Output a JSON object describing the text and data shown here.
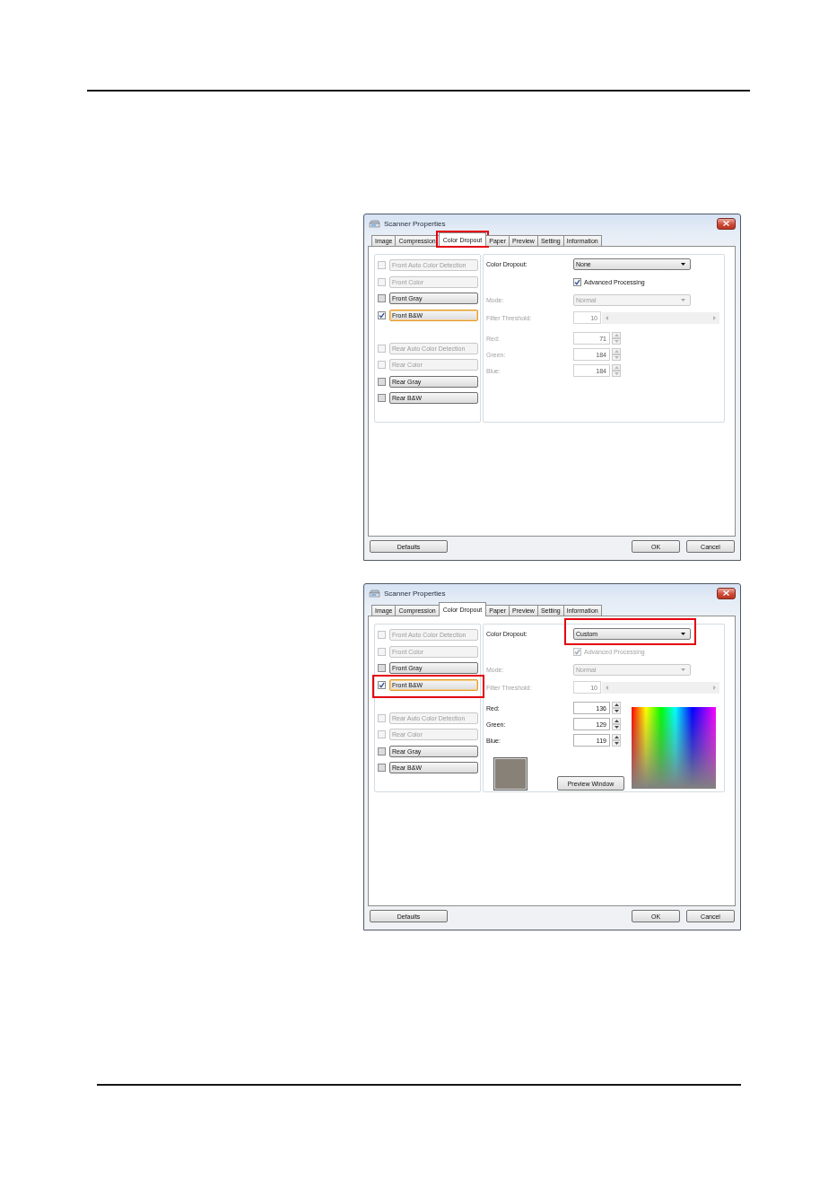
{
  "dialogs": [
    {
      "window": {
        "title": "Scanner Properties"
      },
      "tabs": [
        {
          "label": "Image",
          "selected": false,
          "highlighted": false
        },
        {
          "label": "Compression",
          "selected": false,
          "highlighted": false
        },
        {
          "label": "Color Dropout",
          "selected": true,
          "highlighted": true
        },
        {
          "label": "Paper",
          "selected": false,
          "highlighted": false
        },
        {
          "label": "Preview",
          "selected": false,
          "highlighted": false
        },
        {
          "label": "Setting",
          "selected": false,
          "highlighted": false
        },
        {
          "label": "Information",
          "selected": false,
          "highlighted": false
        }
      ],
      "option_groups": [
        {
          "options": [
            {
              "label": "Front Auto Color Detection",
              "checked": false,
              "disabled": true,
              "focused": false,
              "highlighted": false
            },
            {
              "label": "Front Color",
              "checked": false,
              "disabled": true,
              "focused": false,
              "highlighted": false
            },
            {
              "label": "Front Gray",
              "checked": false,
              "disabled": false,
              "focused": false,
              "highlighted": false
            },
            {
              "label": "Front B&W",
              "checked": true,
              "disabled": false,
              "focused": true,
              "highlighted": false
            }
          ]
        },
        {
          "options": [
            {
              "label": "Rear Auto Color Detection",
              "checked": false,
              "disabled": true,
              "focused": false,
              "highlighted": false
            },
            {
              "label": "Rear Color",
              "checked": false,
              "disabled": true,
              "focused": false,
              "highlighted": false
            },
            {
              "label": "Rear Gray",
              "checked": false,
              "disabled": false,
              "focused": false,
              "highlighted": false
            },
            {
              "label": "Rear B&W",
              "checked": false,
              "disabled": false,
              "focused": false,
              "highlighted": false
            }
          ]
        }
      ],
      "settings": {
        "color_dropout": {
          "label": "Color Dropout:",
          "value": "None",
          "highlighted": false
        },
        "advanced_processing": {
          "label": "Advanced Processing",
          "checked": true,
          "disabled": false
        },
        "mode": {
          "label": "Mode:",
          "value": "Normal",
          "disabled": true
        },
        "filter_threshold": {
          "label": "Filter Threshold:",
          "value": "10",
          "disabled": true
        },
        "channels": [
          {
            "label": "Red:",
            "value": "71",
            "disabled": true
          },
          {
            "label": "Green:",
            "value": "184",
            "disabled": true
          },
          {
            "label": "Blue:",
            "value": "184",
            "disabled": true
          }
        ]
      },
      "buttons": [
        "Defaults",
        "OK",
        "Cancel"
      ]
    },
    {
      "window": {
        "title": "Scanner Properties"
      },
      "tabs": [
        {
          "label": "Image",
          "selected": false,
          "highlighted": false
        },
        {
          "label": "Compression",
          "selected": false,
          "highlighted": false
        },
        {
          "label": "Color Dropout",
          "selected": true,
          "highlighted": false
        },
        {
          "label": "Paper",
          "selected": false,
          "highlighted": false
        },
        {
          "label": "Preview",
          "selected": false,
          "highlighted": false
        },
        {
          "label": "Setting",
          "selected": false,
          "highlighted": false
        },
        {
          "label": "Information",
          "selected": false,
          "highlighted": false
        }
      ],
      "option_groups": [
        {
          "options": [
            {
              "label": "Front Auto Color Detection",
              "checked": false,
              "disabled": true,
              "focused": false,
              "highlighted": false
            },
            {
              "label": "Front Color",
              "checked": false,
              "disabled": true,
              "focused": false,
              "highlighted": false
            },
            {
              "label": "Front Gray",
              "checked": false,
              "disabled": false,
              "focused": false,
              "highlighted": false
            },
            {
              "label": "Front B&W",
              "checked": true,
              "disabled": false,
              "focused": true,
              "highlighted": true
            }
          ]
        },
        {
          "options": [
            {
              "label": "Rear Auto Color Detection",
              "checked": false,
              "disabled": true,
              "focused": false,
              "highlighted": false
            },
            {
              "label": "Rear Color",
              "checked": false,
              "disabled": true,
              "focused": false,
              "highlighted": false
            },
            {
              "label": "Rear Gray",
              "checked": false,
              "disabled": false,
              "focused": false,
              "highlighted": false
            },
            {
              "label": "Rear B&W",
              "checked": false,
              "disabled": false,
              "focused": false,
              "highlighted": false
            }
          ]
        }
      ],
      "settings": {
        "color_dropout": {
          "label": "Color Dropout:",
          "value": "Custom",
          "highlighted": true
        },
        "advanced_processing": {
          "label": "Advanced Processing",
          "checked": true,
          "disabled": true
        },
        "mode": {
          "label": "Mode:",
          "value": "Normal",
          "disabled": true
        },
        "filter_threshold": {
          "label": "Filter Threshold:",
          "value": "10",
          "disabled": true
        },
        "channels": [
          {
            "label": "Red:",
            "value": "136",
            "disabled": false
          },
          {
            "label": "Green:",
            "value": "129",
            "disabled": false
          },
          {
            "label": "Blue:",
            "value": "119",
            "disabled": false
          }
        ],
        "custom_color": {
          "color": "#888177",
          "button": "Preview Window"
        }
      },
      "buttons": [
        "Defaults",
        "OK",
        "Cancel"
      ]
    }
  ]
}
